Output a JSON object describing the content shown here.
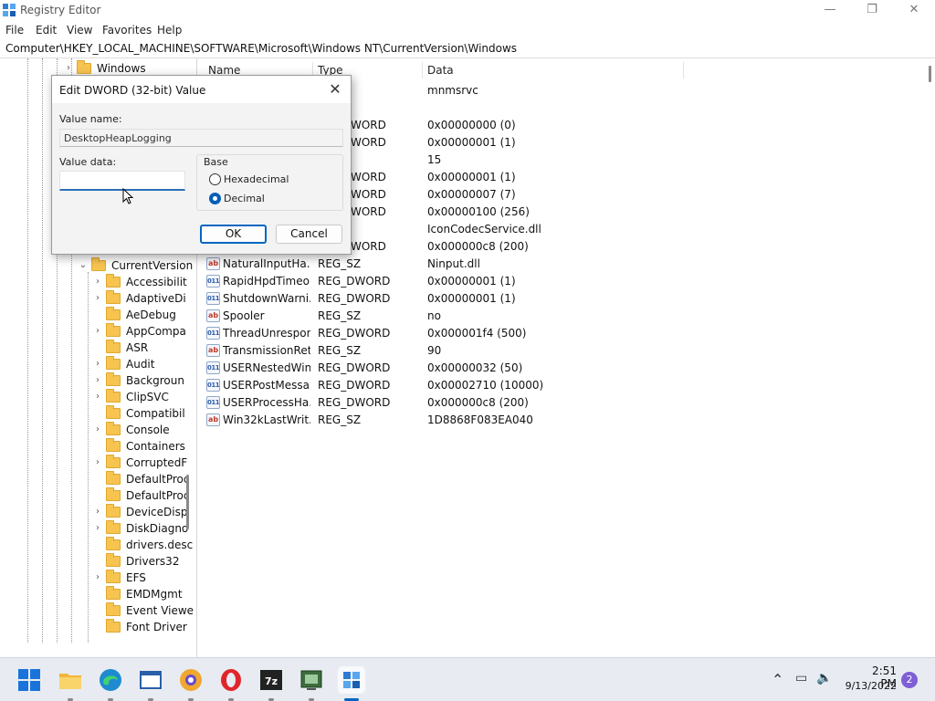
{
  "window": {
    "title": "Registry Editor",
    "controls": {
      "minimize": "—",
      "maximize": "❐",
      "close": "✕"
    }
  },
  "menu": [
    "File",
    "Edit",
    "View",
    "Favorites",
    "Help"
  ],
  "address": "Computer\\HKEY_LOCAL_MACHINE\\SOFTWARE\\Microsoft\\Windows NT\\CurrentVersion\\Windows",
  "tree": {
    "top_item": "Windows",
    "current_key": "CurrentVersion",
    "children": [
      {
        "label": "Accessibilit",
        "expandable": true
      },
      {
        "label": "AdaptiveDi",
        "expandable": true
      },
      {
        "label": "AeDebug",
        "expandable": false
      },
      {
        "label": "AppCompa",
        "expandable": true
      },
      {
        "label": "ASR",
        "expandable": false
      },
      {
        "label": "Audit",
        "expandable": true
      },
      {
        "label": "Backgroun",
        "expandable": true
      },
      {
        "label": "ClipSVC",
        "expandable": true
      },
      {
        "label": "Compatibil",
        "expandable": false
      },
      {
        "label": "Console",
        "expandable": true
      },
      {
        "label": "Containers",
        "expandable": false
      },
      {
        "label": "CorruptedF",
        "expandable": true
      },
      {
        "label": "DefaultProc",
        "expandable": false
      },
      {
        "label": "DefaultProc",
        "expandable": false
      },
      {
        "label": "DeviceDisp",
        "expandable": true
      },
      {
        "label": "DiskDiagno",
        "expandable": true
      },
      {
        "label": "drivers.desc",
        "expandable": false
      },
      {
        "label": "Drivers32",
        "expandable": false
      },
      {
        "label": "EFS",
        "expandable": true
      },
      {
        "label": "EMDMgmt",
        "expandable": false
      },
      {
        "label": "Event Viewe",
        "expandable": false
      },
      {
        "label": "Font Driver",
        "expandable": false
      }
    ]
  },
  "columns": {
    "name": "Name",
    "type": "Type",
    "data": "Data"
  },
  "values_partial": [
    {
      "type": "",
      "data": "mnmsrvc"
    },
    {
      "type": "",
      "data": ""
    },
    {
      "type": "WORD",
      "data": "0x00000000 (0)"
    },
    {
      "type": "WORD",
      "data": "0x00000001 (1)"
    },
    {
      "type": "",
      "data": "15"
    },
    {
      "type": "WORD",
      "data": "0x00000001 (1)"
    },
    {
      "type": "WORD",
      "data": "0x00000007 (7)"
    },
    {
      "type": "WORD",
      "data": "0x00000100 (256)"
    },
    {
      "type": "",
      "data": "IconCodecService.dll"
    },
    {
      "type": "WORD",
      "data": "0x000000c8 (200)"
    }
  ],
  "values": [
    {
      "icon": "sz",
      "name": "NaturalInputHa...",
      "type": "REG_SZ",
      "data": "Ninput.dll"
    },
    {
      "icon": "dword",
      "name": "RapidHpdTimeo...",
      "type": "REG_DWORD",
      "data": "0x00000001 (1)"
    },
    {
      "icon": "dword",
      "name": "ShutdownWarni...",
      "type": "REG_DWORD",
      "data": "0x00000001 (1)"
    },
    {
      "icon": "sz",
      "name": "Spooler",
      "type": "REG_SZ",
      "data": "no"
    },
    {
      "icon": "dword",
      "name": "ThreadUnrespon...",
      "type": "REG_DWORD",
      "data": "0x000001f4 (500)"
    },
    {
      "icon": "sz",
      "name": "TransmissionRet...",
      "type": "REG_SZ",
      "data": "90"
    },
    {
      "icon": "dword",
      "name": "USERNestedWin...",
      "type": "REG_DWORD",
      "data": "0x00000032 (50)"
    },
    {
      "icon": "dword",
      "name": "USERPostMessa...",
      "type": "REG_DWORD",
      "data": "0x00002710 (10000)"
    },
    {
      "icon": "dword",
      "name": "USERProcessHa...",
      "type": "REG_DWORD",
      "data": "0x000000c8 (200)"
    },
    {
      "icon": "sz",
      "name": "Win32kLastWrit...",
      "type": "REG_SZ",
      "data": "1D8868F083EA040"
    }
  ],
  "dialog": {
    "title": "Edit DWORD (32-bit) Value",
    "value_name_label": "Value name:",
    "value_name": "DesktopHeapLogging",
    "value_data_label": "Value data:",
    "value_data": "",
    "base_label": "Base",
    "base_options": [
      "Hexadecimal",
      "Decimal"
    ],
    "base_selected": "Decimal",
    "ok_label": "OK",
    "cancel_label": "Cancel",
    "close_glyph": "✕"
  },
  "taskbar": {
    "apps": [
      "start",
      "file-explorer",
      "edge",
      "notepad-like",
      "chromium-browser",
      "opera",
      "7zip",
      "app-window",
      "registry-editor"
    ],
    "active_app": "registry-editor",
    "time": "2:51 PM",
    "date": "9/13/2022",
    "notification_count": "2",
    "tray": {
      "chevron": "⌃",
      "network": "▭",
      "volume": "🔈"
    }
  },
  "colors": {
    "accent": "#0067c0",
    "folder": "#f6c44f",
    "selection": "#cce4f7",
    "taskbar": "#e8ecf2"
  }
}
